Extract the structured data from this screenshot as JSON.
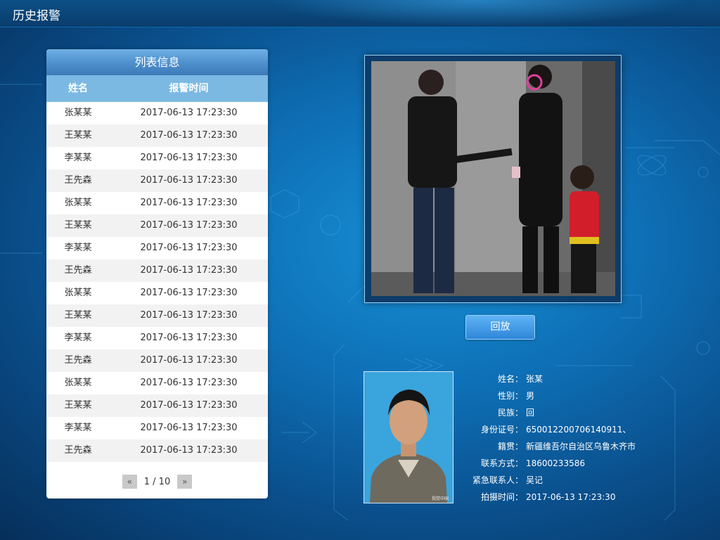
{
  "header": {
    "title": "历史报警"
  },
  "list_panel": {
    "title": "列表信息",
    "columns": {
      "name": "姓名",
      "time": "报警时间"
    },
    "rows": [
      {
        "name": "张某某",
        "time": "2017-06-13  17:23:30"
      },
      {
        "name": "王某某",
        "time": "2017-06-13  17:23:30"
      },
      {
        "name": "李某某",
        "time": "2017-06-13  17:23:30"
      },
      {
        "name": "王先森",
        "time": "2017-06-13  17:23:30"
      },
      {
        "name": "张某某",
        "time": "2017-06-13  17:23:30"
      },
      {
        "name": "王某某",
        "time": "2017-06-13  17:23:30"
      },
      {
        "name": "李某某",
        "time": "2017-06-13  17:23:30"
      },
      {
        "name": "王先森",
        "time": "2017-06-13  17:23:30"
      },
      {
        "name": "张某某",
        "time": "2017-06-13  17:23:30"
      },
      {
        "name": "王某某",
        "time": "2017-06-13  17:23:30"
      },
      {
        "name": "李某某",
        "time": "2017-06-13  17:23:30"
      },
      {
        "name": "王先森",
        "time": "2017-06-13  17:23:30"
      },
      {
        "name": "张某某",
        "time": "2017-06-13  17:23:30"
      },
      {
        "name": "王某某",
        "time": "2017-06-13  17:23:30"
      },
      {
        "name": "李某某",
        "time": "2017-06-13  17:23:30"
      },
      {
        "name": "王先森",
        "time": "2017-06-13  17:23:30"
      }
    ],
    "pagination": {
      "prev": "«",
      "next": "»",
      "page": "1 / 10"
    }
  },
  "viewer": {
    "replay_label": "回放"
  },
  "person": {
    "fields": [
      {
        "label": "姓名：",
        "value": "张某"
      },
      {
        "label": "性别：",
        "value": "男"
      },
      {
        "label": "民族：",
        "value": "回"
      },
      {
        "label": "身份证号：",
        "value": "650012200706140911、"
      },
      {
        "label": "籍贯：",
        "value": "新疆维吾尔自治区乌鲁木齐市"
      },
      {
        "label": "联系方式：",
        "value": "18600233586"
      },
      {
        "label": "紧急联系人：",
        "value": "吴记"
      },
      {
        "label": "拍摄时间：",
        "value": "2017-06-13   17:23:30"
      }
    ]
  },
  "colors": {
    "accent": "#4e8fcc",
    "header_bg": "#0a3d6c",
    "button": "#2e86d8"
  },
  "icons": [
    "page-prev-icon",
    "page-next-icon"
  ]
}
